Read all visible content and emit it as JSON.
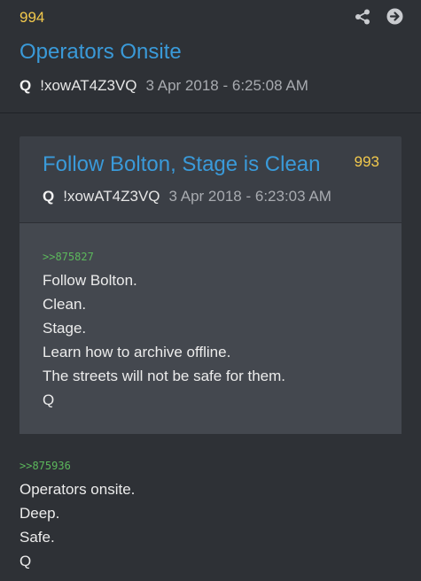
{
  "post": {
    "number": "994",
    "title": "Operators Onsite",
    "author": "Q",
    "tripcode": "!xowAT4Z3VQ",
    "timestamp": "3 Apr 2018 - 6:25:08 AM",
    "reference": ">>875936",
    "lines": [
      "Operators onsite.",
      "Deep.",
      "Safe.",
      "Q"
    ]
  },
  "actions": {
    "share_icon": "share-icon",
    "open_icon": "arrow-right-circle-icon"
  },
  "quoted_post": {
    "number": "993",
    "title": "Follow Bolton, Stage is Clean",
    "author": "Q",
    "tripcode": "!xowAT4Z3VQ",
    "timestamp": "3 Apr 2018 - 6:23:03 AM",
    "reference": ">>875827",
    "lines": [
      "Follow Bolton.",
      "Clean.",
      "Stage.",
      "Learn how to archive offline.",
      "The streets will not be safe for them.",
      "Q"
    ]
  },
  "colors": {
    "background": "#2e3136",
    "accent_blue": "#3a9ad9",
    "number_yellow": "#f2c94c",
    "link_green": "#5cb85c"
  }
}
